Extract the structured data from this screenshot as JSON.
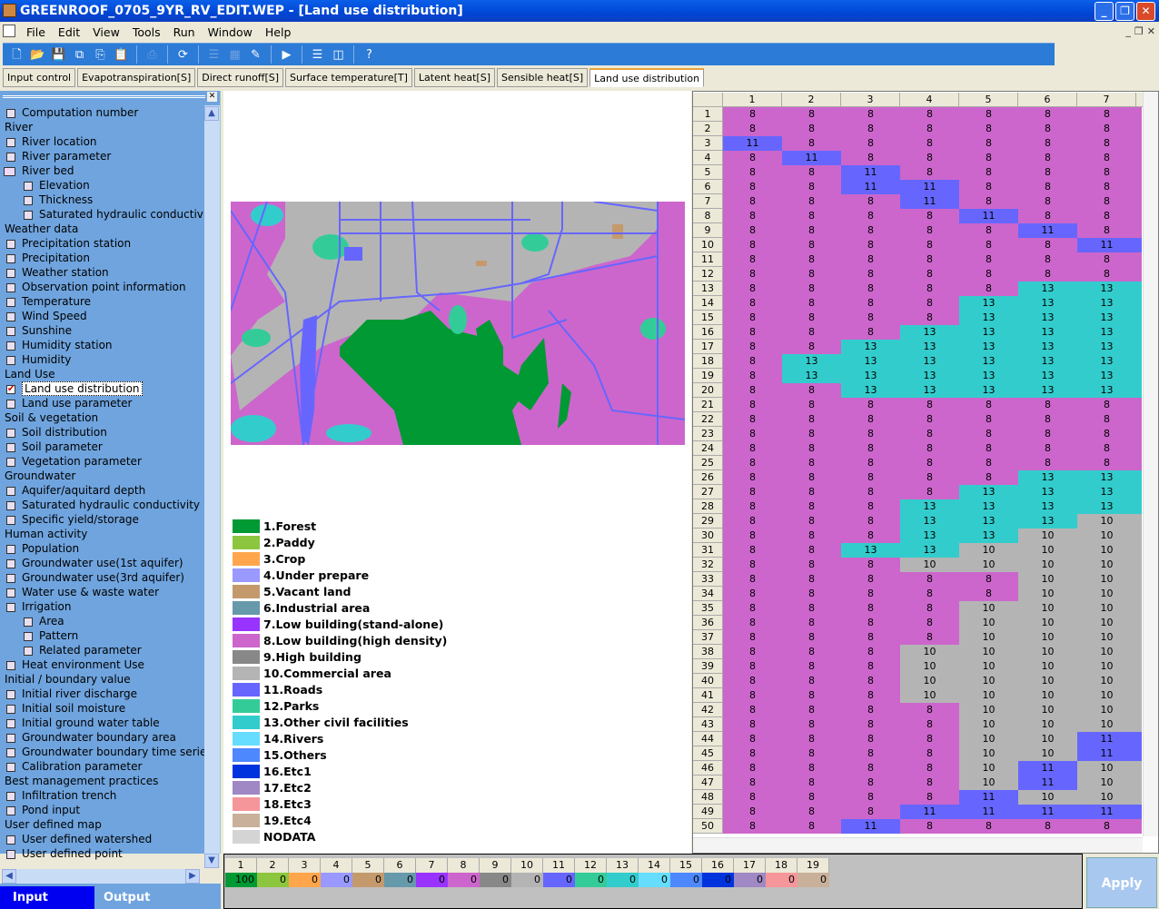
{
  "window": {
    "title": "GREENROOF_0705_9YR_RV_EDIT.WEP - [Land use distribution]"
  },
  "menu": [
    "File",
    "Edit",
    "View",
    "Tools",
    "Run",
    "Window",
    "Help"
  ],
  "toolbar_icons": [
    "new-icon",
    "open-icon",
    "save-icon",
    "save-all-icon",
    "copy-icon",
    "paste-icon",
    "print-icon",
    "refresh-icon",
    "list-icon",
    "chart-icon",
    "pencil-icon",
    "run-icon",
    "rows-icon",
    "columns-icon",
    "help-icon"
  ],
  "tabs": [
    {
      "label": "Input control"
    },
    {
      "label": "Evapotranspiration[S]"
    },
    {
      "label": "Direct runoff[S]"
    },
    {
      "label": "Surface temperature[T]"
    },
    {
      "label": "Latent heat[S]"
    },
    {
      "label": "Sensible heat[S]"
    },
    {
      "label": "Land use distribution",
      "active": true
    }
  ],
  "sidebar": {
    "items": [
      {
        "label": "Computation number",
        "t": "item"
      },
      {
        "label": "River",
        "t": "head"
      },
      {
        "label": "River location",
        "t": "item"
      },
      {
        "label": "River parameter",
        "t": "item"
      },
      {
        "label": "River bed",
        "t": "folder"
      },
      {
        "label": "Elevation",
        "t": "sub"
      },
      {
        "label": "Thickness",
        "t": "sub"
      },
      {
        "label": "Saturated hydraulic conductivity",
        "t": "sub"
      },
      {
        "label": "Weather data",
        "t": "head"
      },
      {
        "label": "Precipitation station",
        "t": "item"
      },
      {
        "label": "Precipitation",
        "t": "item"
      },
      {
        "label": "Weather station",
        "t": "item"
      },
      {
        "label": "Observation point information",
        "t": "item"
      },
      {
        "label": "Temperature",
        "t": "item"
      },
      {
        "label": "Wind Speed",
        "t": "item"
      },
      {
        "label": "Sunshine",
        "t": "item"
      },
      {
        "label": "Humidity station",
        "t": "item"
      },
      {
        "label": "Humidity",
        "t": "item"
      },
      {
        "label": "Land Use",
        "t": "head"
      },
      {
        "label": "Land use distribution",
        "t": "item",
        "checked": true,
        "selected": true
      },
      {
        "label": "Land use parameter",
        "t": "item"
      },
      {
        "label": "Soil & vegetation",
        "t": "head"
      },
      {
        "label": "Soil distribution",
        "t": "item"
      },
      {
        "label": "Soil parameter",
        "t": "item"
      },
      {
        "label": "Vegetation parameter",
        "t": "item"
      },
      {
        "label": "Groundwater",
        "t": "head"
      },
      {
        "label": "Aquifer/aquitard depth",
        "t": "item"
      },
      {
        "label": "Saturated hydraulic conductivity",
        "t": "item"
      },
      {
        "label": "Specific yield/storage",
        "t": "item"
      },
      {
        "label": "Human activity",
        "t": "head"
      },
      {
        "label": "Population",
        "t": "item"
      },
      {
        "label": "Groundwater use(1st aquifer)",
        "t": "item"
      },
      {
        "label": "Groundwater use(3rd aquifer)",
        "t": "item"
      },
      {
        "label": "Water use & waste water",
        "t": "item"
      },
      {
        "label": "Irrigation",
        "t": "item"
      },
      {
        "label": "Area",
        "t": "sub"
      },
      {
        "label": "Pattern",
        "t": "sub"
      },
      {
        "label": "Related parameter",
        "t": "sub"
      },
      {
        "label": "Heat environment Use",
        "t": "item"
      },
      {
        "label": "Initial / boundary value",
        "t": "head"
      },
      {
        "label": "Initial river discharge",
        "t": "item"
      },
      {
        "label": "Initial soil moisture",
        "t": "item"
      },
      {
        "label": "Initial ground water table",
        "t": "item"
      },
      {
        "label": "Groundwater boundary area",
        "t": "item"
      },
      {
        "label": "Groundwater boundary time series",
        "t": "item"
      },
      {
        "label": "Calibration parameter",
        "t": "item"
      },
      {
        "label": "Best management practices",
        "t": "head"
      },
      {
        "label": "Infiltration trench",
        "t": "item"
      },
      {
        "label": "Pond input",
        "t": "item"
      },
      {
        "label": "User defined map",
        "t": "head"
      },
      {
        "label": "User defined watershed",
        "t": "item"
      },
      {
        "label": "User defined point",
        "t": "item"
      }
    ]
  },
  "io_tabs": {
    "input": "Input",
    "output": "Output"
  },
  "legend": [
    {
      "label": "1.Forest",
      "color": "#009933"
    },
    {
      "label": "2.Paddy",
      "color": "#8cc63f"
    },
    {
      "label": "3.Crop",
      "color": "#ffa64d"
    },
    {
      "label": "4.Under prepare",
      "color": "#9999ff"
    },
    {
      "label": "5.Vacant land",
      "color": "#c49a6c"
    },
    {
      "label": "6.Industrial area",
      "color": "#6699aa"
    },
    {
      "label": "7.Low building(stand-alone)",
      "color": "#9933ff"
    },
    {
      "label": "8.Low building(high density)",
      "color": "#cc66cc"
    },
    {
      "label": "9.High building",
      "color": "#888888"
    },
    {
      "label": "10.Commercial area",
      "color": "#b4b4b4"
    },
    {
      "label": "11.Roads",
      "color": "#6666ff"
    },
    {
      "label": "12.Parks",
      "color": "#33cc99"
    },
    {
      "label": "13.Other civil facilities",
      "color": "#33cccc"
    },
    {
      "label": "14.Rivers",
      "color": "#66ddff"
    },
    {
      "label": "15.Others",
      "color": "#4d88ff"
    },
    {
      "label": "16.Etc1",
      "color": "#0033dd"
    },
    {
      "label": "17.Etc2",
      "color": "#9f88c4"
    },
    {
      "label": "18.Etc3",
      "color": "#f5969a"
    },
    {
      "label": "19.Etc4",
      "color": "#c8b09a"
    },
    {
      "label": "NODATA",
      "color": "#d4d4d4"
    }
  ],
  "grid": {
    "columns": [
      "1",
      "2",
      "3",
      "4",
      "5",
      "6",
      "7"
    ],
    "rows": [
      [
        8,
        8,
        8,
        8,
        8,
        8,
        8
      ],
      [
        8,
        8,
        8,
        8,
        8,
        8,
        8
      ],
      [
        11,
        8,
        8,
        8,
        8,
        8,
        8
      ],
      [
        8,
        11,
        8,
        8,
        8,
        8,
        8
      ],
      [
        8,
        8,
        11,
        8,
        8,
        8,
        8
      ],
      [
        8,
        8,
        11,
        11,
        8,
        8,
        8
      ],
      [
        8,
        8,
        8,
        11,
        8,
        8,
        8
      ],
      [
        8,
        8,
        8,
        8,
        11,
        8,
        8
      ],
      [
        8,
        8,
        8,
        8,
        8,
        11,
        8
      ],
      [
        8,
        8,
        8,
        8,
        8,
        8,
        11
      ],
      [
        8,
        8,
        8,
        8,
        8,
        8,
        8
      ],
      [
        8,
        8,
        8,
        8,
        8,
        8,
        8
      ],
      [
        8,
        8,
        8,
        8,
        8,
        13,
        13
      ],
      [
        8,
        8,
        8,
        8,
        13,
        13,
        13
      ],
      [
        8,
        8,
        8,
        8,
        13,
        13,
        13
      ],
      [
        8,
        8,
        8,
        13,
        13,
        13,
        13
      ],
      [
        8,
        8,
        13,
        13,
        13,
        13,
        13
      ],
      [
        8,
        13,
        13,
        13,
        13,
        13,
        13
      ],
      [
        8,
        13,
        13,
        13,
        13,
        13,
        13
      ],
      [
        8,
        8,
        13,
        13,
        13,
        13,
        13
      ],
      [
        8,
        8,
        8,
        8,
        8,
        8,
        8
      ],
      [
        8,
        8,
        8,
        8,
        8,
        8,
        8
      ],
      [
        8,
        8,
        8,
        8,
        8,
        8,
        8
      ],
      [
        8,
        8,
        8,
        8,
        8,
        8,
        8
      ],
      [
        8,
        8,
        8,
        8,
        8,
        8,
        8
      ],
      [
        8,
        8,
        8,
        8,
        8,
        13,
        13
      ],
      [
        8,
        8,
        8,
        8,
        13,
        13,
        13
      ],
      [
        8,
        8,
        8,
        13,
        13,
        13,
        13
      ],
      [
        8,
        8,
        8,
        13,
        13,
        13,
        10
      ],
      [
        8,
        8,
        8,
        13,
        13,
        10,
        10
      ],
      [
        8,
        8,
        13,
        13,
        10,
        10,
        10
      ],
      [
        8,
        8,
        8,
        10,
        10,
        10,
        10
      ],
      [
        8,
        8,
        8,
        8,
        8,
        10,
        10
      ],
      [
        8,
        8,
        8,
        8,
        8,
        10,
        10
      ],
      [
        8,
        8,
        8,
        8,
        10,
        10,
        10
      ],
      [
        8,
        8,
        8,
        8,
        10,
        10,
        10
      ],
      [
        8,
        8,
        8,
        8,
        10,
        10,
        10
      ],
      [
        8,
        8,
        8,
        10,
        10,
        10,
        10
      ],
      [
        8,
        8,
        8,
        10,
        10,
        10,
        10
      ],
      [
        8,
        8,
        8,
        10,
        10,
        10,
        10
      ],
      [
        8,
        8,
        8,
        10,
        10,
        10,
        10
      ],
      [
        8,
        8,
        8,
        8,
        10,
        10,
        10
      ],
      [
        8,
        8,
        8,
        8,
        10,
        10,
        10
      ],
      [
        8,
        8,
        8,
        8,
        10,
        10,
        11
      ],
      [
        8,
        8,
        8,
        8,
        10,
        10,
        11
      ],
      [
        8,
        8,
        8,
        8,
        10,
        11,
        10
      ],
      [
        8,
        8,
        8,
        8,
        10,
        11,
        10
      ],
      [
        8,
        8,
        8,
        8,
        11,
        10,
        10
      ],
      [
        8,
        8,
        8,
        11,
        11,
        11,
        11
      ],
      [
        8,
        8,
        11,
        8,
        8,
        8,
        8
      ]
    ]
  },
  "summary": {
    "headers": [
      "1",
      "2",
      "3",
      "4",
      "5",
      "6",
      "7",
      "8",
      "9",
      "10",
      "11",
      "12",
      "13",
      "14",
      "15",
      "16",
      "17",
      "18",
      "19"
    ],
    "values": [
      "100",
      "0",
      "0",
      "0",
      "0",
      "0",
      "0",
      "0",
      "0",
      "0",
      "0",
      "0",
      "0",
      "0",
      "0",
      "0",
      "0",
      "0",
      "0"
    ]
  },
  "apply_label": "Apply"
}
